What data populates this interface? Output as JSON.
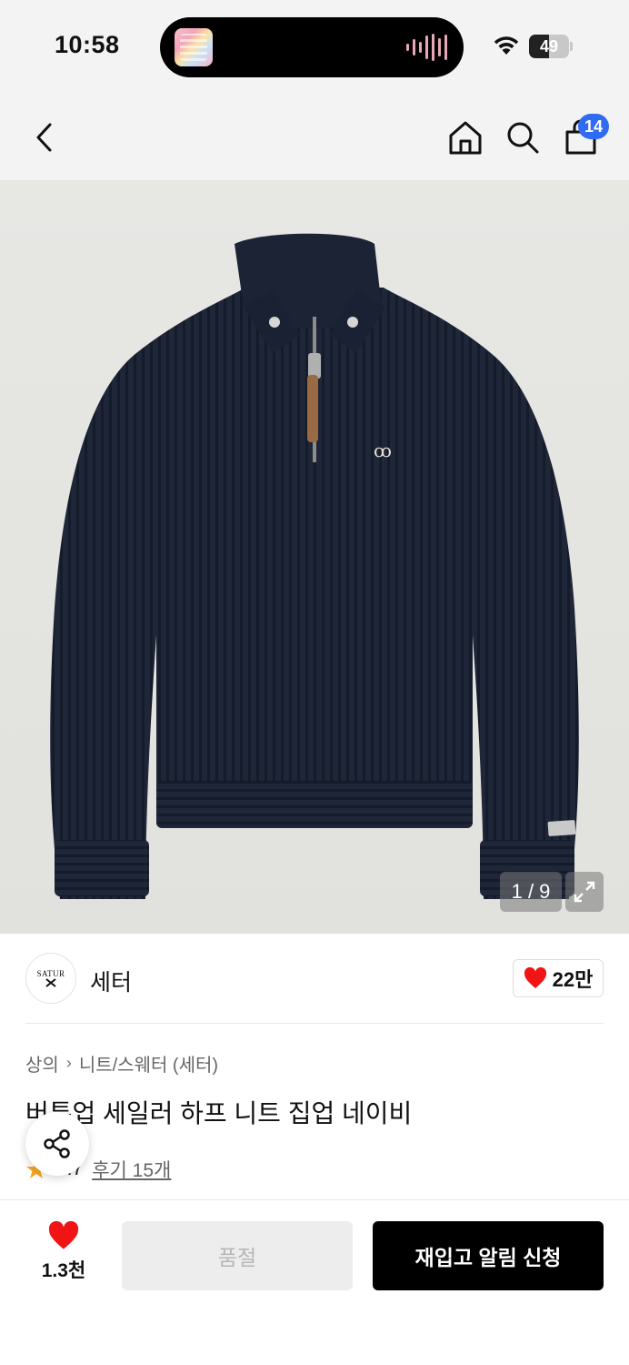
{
  "status_bar": {
    "time": "10:58",
    "battery_level": "49",
    "battery_fraction": 0.49,
    "wifi_icon": "wifi-icon",
    "island_icon": "audio-waveform-icon"
  },
  "nav": {
    "back_icon": "chevron-left-icon",
    "home_icon": "home-icon",
    "search_icon": "search-icon",
    "cart_icon": "shopping-bag-icon",
    "cart_badge": "14"
  },
  "gallery": {
    "counter": "1 / 9",
    "expand_icon": "expand-icon"
  },
  "brand": {
    "logo_text": "SATUR",
    "name": "세터",
    "like_count": "22만"
  },
  "product": {
    "breadcrumb": [
      "상의",
      "니트/스웨터 (세터)"
    ],
    "title": "버튼업 세일러 하프 니트 집업 네이비",
    "rating": "4.7",
    "reviews": "후기 15개"
  },
  "bottom": {
    "wish_count": "1.3천",
    "soldout_label": "품절",
    "restock_label": "재입고 알림 신청"
  },
  "colors": {
    "badge": "#2f6bf3",
    "heart": "#f01414",
    "star": "#f5a623",
    "sweater": "#1c2436"
  }
}
